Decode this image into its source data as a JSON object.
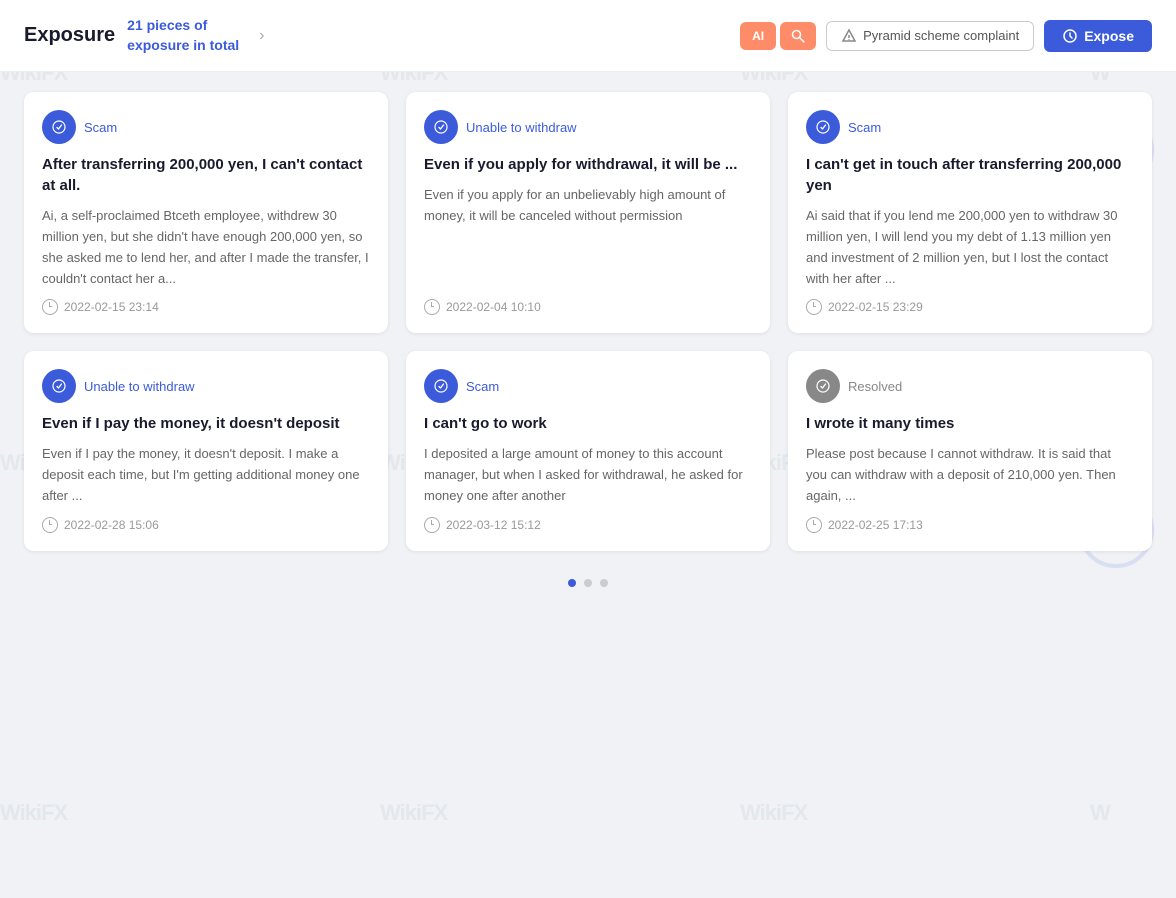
{
  "header": {
    "exposure_label": "Exposure",
    "exposure_count": "21 pieces of exposure in total",
    "chevron": "›",
    "ai_badge_ai": "AI",
    "ai_badge_search": "🔍",
    "pyramid_label": "Pyramid scheme complaint",
    "expose_label": "Expose"
  },
  "cards": [
    {
      "badge_type": "scam",
      "badge_label": "Scam",
      "title": "After transferring 200,000 yen, I can't contact at all.",
      "desc": "Ai, a self-proclaimed Btceth employee, withdrew 30 million yen, but she didn't have enough 200,000 yen, so she asked me to lend her, and after I made the transfer, I couldn't contact her a...",
      "date": "2022-02-15 23:14"
    },
    {
      "badge_type": "unable",
      "badge_label": "Unable to withdraw",
      "title": "Even if you apply for withdrawal, it will be ...",
      "desc": "Even if you apply for an unbelievably high amount of money, it will be canceled without permission",
      "date": "2022-02-04 10:10"
    },
    {
      "badge_type": "scam",
      "badge_label": "Scam",
      "title": "I can't get in touch after transferring 200,000 yen",
      "desc": "Ai said that if you lend me 200,000 yen to withdraw 30 million yen, I will lend you my debt of 1.13 million yen and investment of 2 million yen, but I lost the contact with her after ...",
      "date": "2022-02-15 23:29"
    },
    {
      "badge_type": "unable",
      "badge_label": "Unable to withdraw",
      "title": "Even if I pay the money, it doesn't deposit",
      "desc": "Even if I pay the money, it doesn't deposit. I make a deposit each time, but I'm getting additional money one after ...",
      "date": "2022-02-28 15:06"
    },
    {
      "badge_type": "scam",
      "badge_label": "Scam",
      "title": "I can't go to work",
      "desc": "I deposited a large amount of money to this account manager, but when I asked for withdrawal, he asked for money one after another",
      "date": "2022-03-12 15:12"
    },
    {
      "badge_type": "resolved",
      "badge_label": "Resolved",
      "title": "I wrote it many times",
      "desc": "Please post because I cannot withdraw. It is said that you can withdraw with a deposit of 210,000 yen. Then again, ...",
      "date": "2022-02-25 17:13"
    }
  ],
  "pagination": {
    "dots": [
      true,
      false,
      false
    ],
    "active_index": 0
  }
}
